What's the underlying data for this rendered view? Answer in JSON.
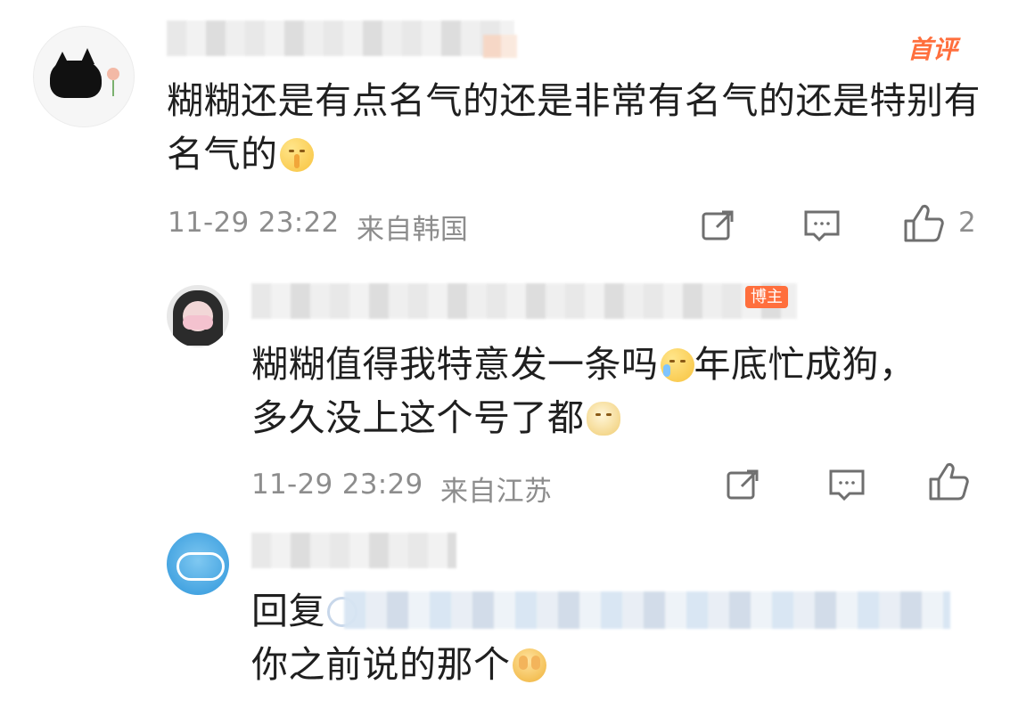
{
  "comments": [
    {
      "user_initial": "",
      "badge": "首评",
      "text": "糊糊还是有点名气的还是非常有名气的还是特别有名气的",
      "emoji": "shush-face-emoji",
      "time": "11-29 23:22",
      "location": "来自韩国",
      "like_count": "2"
    },
    {
      "user_initial": "",
      "badge": "博主",
      "text_line1": "糊糊值得我特意发一条吗",
      "text_line1_suffix": "年底忙成狗，",
      "text_line2": "多久没上这个号了都",
      "emoji_1": "laughing-tears-emoji",
      "emoji_2": "doge-emoji",
      "time": "11-29 23:29",
      "location": "来自江苏"
    },
    {
      "user_initial": "",
      "reply_prefix": "回复",
      "text_line2": "你之前说的那个",
      "emoji": "covered-face-emoji"
    }
  ],
  "colors": {
    "badge_orange": "#ff6f3d",
    "meta_gray": "#8d8d8d"
  }
}
